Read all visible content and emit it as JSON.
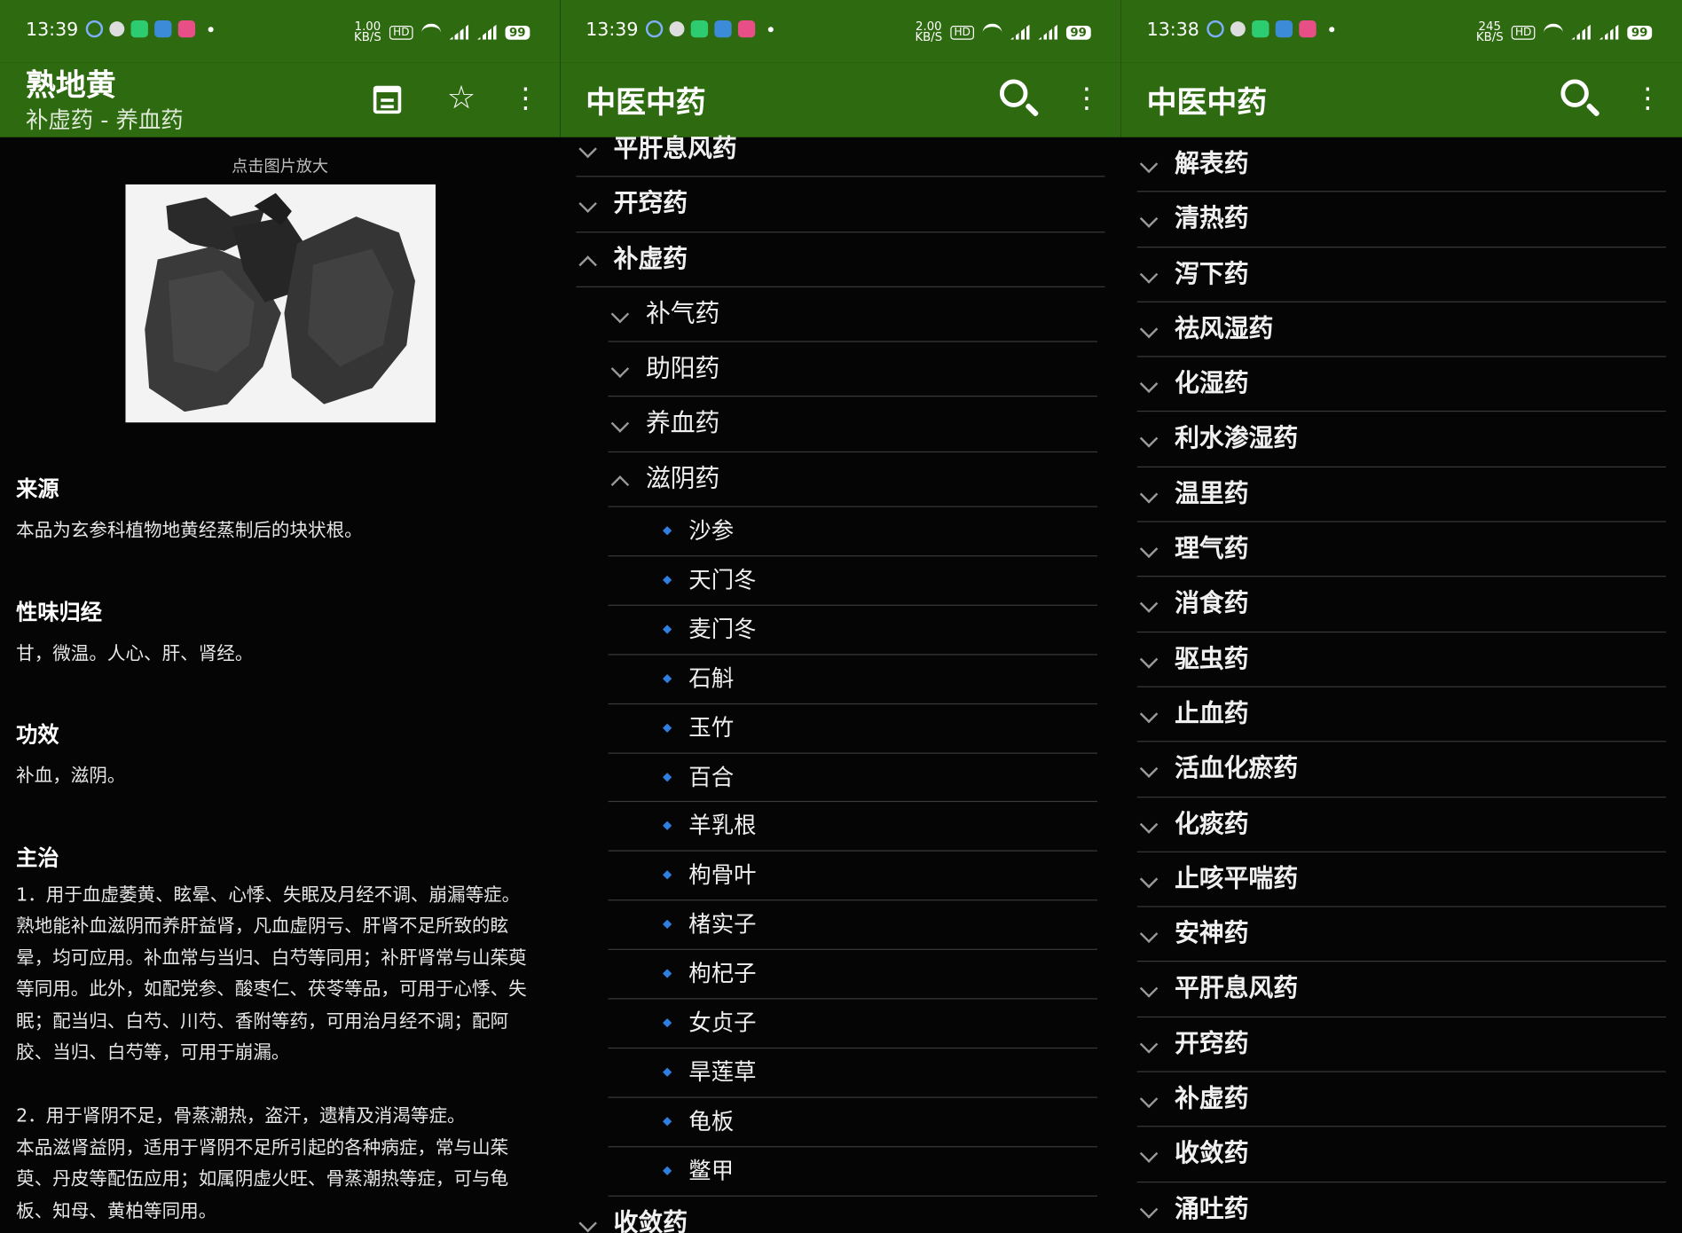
{
  "status": [
    {
      "time": "13:39",
      "speed": "1.00",
      "speed_unit": "KB/S",
      "hd": "HD",
      "battery": "99"
    },
    {
      "time": "13:39",
      "speed": "2.00",
      "speed_unit": "KB/S",
      "hd": "HD",
      "battery": "99"
    },
    {
      "time": "13:38",
      "speed": "245",
      "speed_unit": "KB/S",
      "hd": "HD",
      "battery": "99"
    }
  ],
  "detail": {
    "title": "熟地黄",
    "subtitle": "补虚药 - 养血药",
    "image_hint": "点击图片放大",
    "sections": [
      {
        "heading": "来源",
        "body": "本品为玄参科植物地黄经蒸制后的块状根。"
      },
      {
        "heading": "性味归经",
        "body": "甘，微温。人心、肝、肾经。"
      },
      {
        "heading": "功效",
        "body": "补血，滋阴。"
      },
      {
        "heading": "主治",
        "body": "1．用于血虚萎黄、眩晕、心悸、失眠及月经不调、崩漏等症。\n熟地能补血滋阴而养肝益肾，凡血虚阴亏、肝肾不足所致的眩晕，均可应用。补血常与当归、白芍等同用；补肝肾常与山茱萸等同用。此外，如配党参、酸枣仁、茯苓等品，可用于心悸、失眠；配当归、白芍、川芍、香附等药，可用治月经不调；配阿胶、当归、白芍等，可用于崩漏。\n\n2．用于肾阴不足，骨蒸潮热，盗汗，遗精及消渴等症。\n本品滋肾益阴，适用于肾阴不足所引起的各种病症，常与山茱萸、丹皮等配伍应用；如属阴虚火旺、骨蒸潮热等症，可与龟板、知母、黄柏等同用。"
      }
    ]
  },
  "tree_view": {
    "title": "中医中药",
    "rows": [
      {
        "level": 1,
        "label": "平肝息风药",
        "expanded": false
      },
      {
        "level": 1,
        "label": "开窍药",
        "expanded": false
      },
      {
        "level": 1,
        "label": "补虚药",
        "expanded": true
      },
      {
        "level": 2,
        "label": "补气药",
        "expanded": false
      },
      {
        "level": 2,
        "label": "助阳药",
        "expanded": false
      },
      {
        "level": 2,
        "label": "养血药",
        "expanded": false
      },
      {
        "level": 2,
        "label": "滋阴药",
        "expanded": true
      },
      {
        "level": 3,
        "label": "沙参"
      },
      {
        "level": 3,
        "label": "天门冬"
      },
      {
        "level": 3,
        "label": "麦门冬"
      },
      {
        "level": 3,
        "label": "石斛"
      },
      {
        "level": 3,
        "label": "玉竹"
      },
      {
        "level": 3,
        "label": "百合"
      },
      {
        "level": 3,
        "label": "羊乳根"
      },
      {
        "level": 3,
        "label": "枸骨叶"
      },
      {
        "level": 3,
        "label": "楮实子"
      },
      {
        "level": 3,
        "label": "枸杞子"
      },
      {
        "level": 3,
        "label": "女贞子"
      },
      {
        "level": 3,
        "label": "旱莲草"
      },
      {
        "level": 3,
        "label": "龟板"
      },
      {
        "level": 3,
        "label": "鳖甲"
      },
      {
        "level": 1,
        "label": "收敛药",
        "expanded": false
      }
    ]
  },
  "category_view": {
    "title": "中医中药",
    "rows": [
      {
        "level": 1,
        "label": "解表药",
        "expanded": false
      },
      {
        "level": 1,
        "label": "清热药",
        "expanded": false
      },
      {
        "level": 1,
        "label": "泻下药",
        "expanded": false
      },
      {
        "level": 1,
        "label": "祛风湿药",
        "expanded": false
      },
      {
        "level": 1,
        "label": "化湿药",
        "expanded": false
      },
      {
        "level": 1,
        "label": "利水渗湿药",
        "expanded": false
      },
      {
        "level": 1,
        "label": "温里药",
        "expanded": false
      },
      {
        "level": 1,
        "label": "理气药",
        "expanded": false
      },
      {
        "level": 1,
        "label": "消食药",
        "expanded": false
      },
      {
        "level": 1,
        "label": "驱虫药",
        "expanded": false
      },
      {
        "level": 1,
        "label": "止血药",
        "expanded": false
      },
      {
        "level": 1,
        "label": "活血化瘀药",
        "expanded": false
      },
      {
        "level": 1,
        "label": "化痰药",
        "expanded": false
      },
      {
        "level": 1,
        "label": "止咳平喘药",
        "expanded": false
      },
      {
        "level": 1,
        "label": "安神药",
        "expanded": false
      },
      {
        "level": 1,
        "label": "平肝息风药",
        "expanded": false
      },
      {
        "level": 1,
        "label": "开窍药",
        "expanded": false
      },
      {
        "level": 1,
        "label": "补虚药",
        "expanded": false
      },
      {
        "level": 1,
        "label": "收敛药",
        "expanded": false
      },
      {
        "level": 1,
        "label": "涌吐药",
        "expanded": false
      }
    ]
  },
  "icons": {
    "calendar": "calendar-icon",
    "star": "star-icon",
    "more": "more-vert-icon",
    "search": "search-icon",
    "chevron": "chevron-icon",
    "bullet": "diamond-bullet-icon"
  },
  "colors": {
    "toolbar": "#2e6a10",
    "background": "#050505",
    "bullet": "#2f7fe0",
    "divider": "#3a3a3a"
  }
}
